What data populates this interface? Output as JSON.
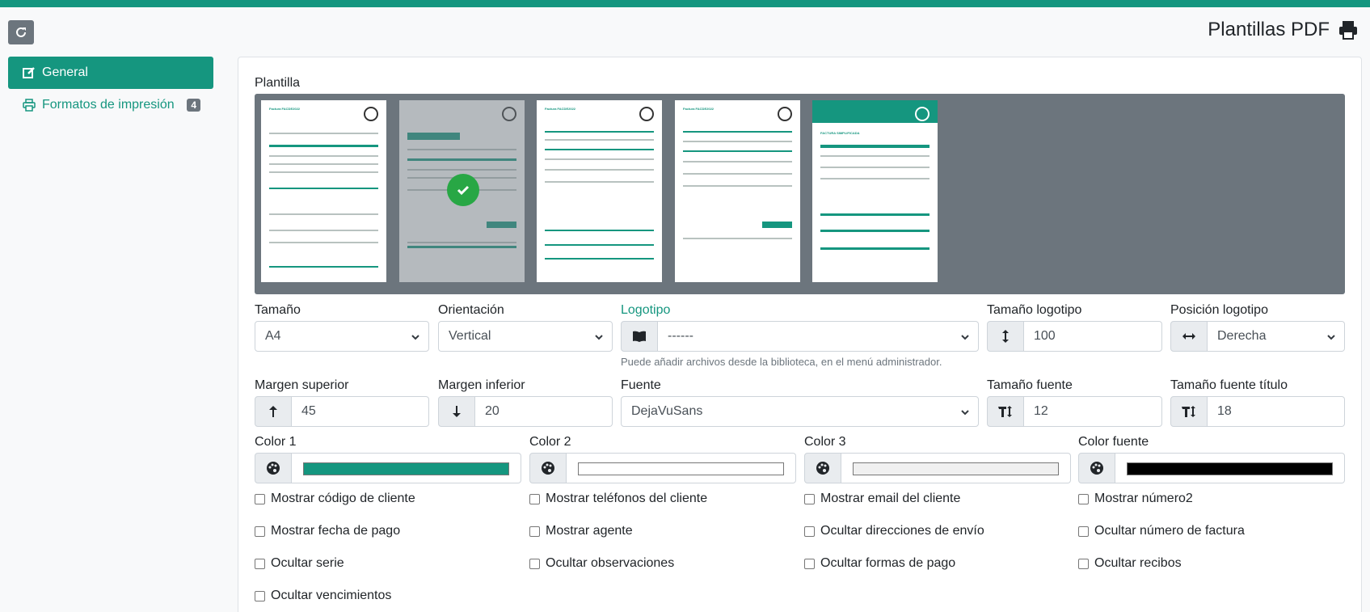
{
  "header": {
    "title": "Plantillas PDF"
  },
  "sidebar": {
    "items": [
      {
        "label": "General",
        "active": true
      },
      {
        "label": "Formatos de impresión",
        "badge": "4"
      }
    ]
  },
  "form": {
    "template_label": "Plantilla",
    "template_thumb_titles": [
      "Factura FACDE2022",
      "FACTURA FACDE2022",
      "Factura FACDE2022",
      "Factura FACDE2022",
      "FACTURA SIMPLIFICADA"
    ],
    "size": {
      "label": "Tamaño",
      "value": "A4"
    },
    "orientation": {
      "label": "Orientación",
      "value": "Vertical"
    },
    "logo": {
      "label": "Logotipo",
      "value": "------",
      "help": "Puede añadir archivos desde la biblioteca, en el menú administrador."
    },
    "logo_size": {
      "label": "Tamaño logotipo",
      "value": "100"
    },
    "logo_position": {
      "label": "Posición logotipo",
      "value": "Derecha"
    },
    "margin_top": {
      "label": "Margen superior",
      "value": "45"
    },
    "margin_bottom": {
      "label": "Margen inferior",
      "value": "20"
    },
    "font": {
      "label": "Fuente",
      "value": "DejaVuSans"
    },
    "font_size": {
      "label": "Tamaño fuente",
      "value": "12"
    },
    "title_font_size": {
      "label": "Tamaño fuente título",
      "value": "18"
    },
    "colors": [
      {
        "label": "Color 1",
        "value": "#15967f"
      },
      {
        "label": "Color 2",
        "value": "#ffffff"
      },
      {
        "label": "Color 3",
        "value": "#f0f0f0"
      },
      {
        "label": "Color fuente",
        "value": "#000000"
      }
    ],
    "checkboxes": [
      "Mostrar código de cliente",
      "Mostrar teléfonos del cliente",
      "Mostrar email del cliente",
      "Mostrar número2",
      "Mostrar fecha de pago",
      "Mostrar agente",
      "Ocultar direcciones de envío",
      "Ocultar número de factura",
      "Ocultar serie",
      "Ocultar observaciones",
      "Ocultar formas de pago",
      "Ocultar recibos",
      "Ocultar vencimientos"
    ]
  }
}
